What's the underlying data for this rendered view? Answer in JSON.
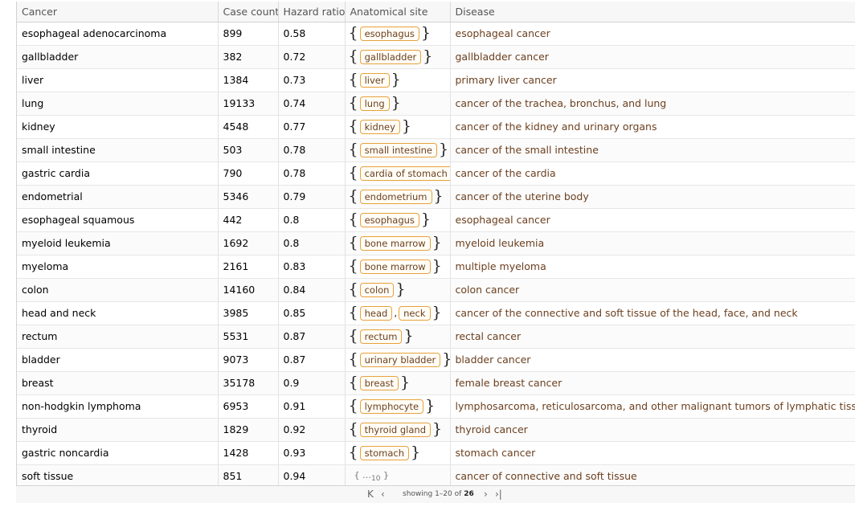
{
  "columns": [
    "Cancer",
    "Case count",
    "Hazard ratio",
    "Anatomical site",
    "Disease"
  ],
  "rows": [
    {
      "cancer": "esophageal adenocarcinoma",
      "count": "899",
      "hazard": "0.58",
      "sites": [
        "esophagus"
      ],
      "disease": "esophageal cancer"
    },
    {
      "cancer": "gallbladder",
      "count": "382",
      "hazard": "0.72",
      "sites": [
        "gallbladder"
      ],
      "disease": "gallbladder cancer"
    },
    {
      "cancer": "liver",
      "count": "1384",
      "hazard": "0.73",
      "sites": [
        "liver"
      ],
      "disease": "primary liver cancer"
    },
    {
      "cancer": "lung",
      "count": "19133",
      "hazard": "0.74",
      "sites": [
        "lung"
      ],
      "disease": "cancer of the trachea, bronchus, and lung"
    },
    {
      "cancer": "kidney",
      "count": "4548",
      "hazard": "0.77",
      "sites": [
        "kidney"
      ],
      "disease": "cancer of the kidney and urinary organs"
    },
    {
      "cancer": "small intestine",
      "count": "503",
      "hazard": "0.78",
      "sites": [
        "small intestine"
      ],
      "disease": "cancer of the small intestine"
    },
    {
      "cancer": "gastric cardia",
      "count": "790",
      "hazard": "0.78",
      "sites": [
        "cardia of stomach"
      ],
      "disease": "cancer of the cardia"
    },
    {
      "cancer": "endometrial",
      "count": "5346",
      "hazard": "0.79",
      "sites": [
        "endometrium"
      ],
      "disease": "cancer of the uterine body"
    },
    {
      "cancer": "esophageal squamous",
      "count": "442",
      "hazard": "0.8",
      "sites": [
        "esophagus"
      ],
      "disease": "esophageal cancer"
    },
    {
      "cancer": "myeloid leukemia",
      "count": "1692",
      "hazard": "0.8",
      "sites": [
        "bone marrow"
      ],
      "disease": "myeloid leukemia"
    },
    {
      "cancer": "myeloma",
      "count": "2161",
      "hazard": "0.83",
      "sites": [
        "bone marrow"
      ],
      "disease": "multiple myeloma"
    },
    {
      "cancer": "colon",
      "count": "14160",
      "hazard": "0.84",
      "sites": [
        "colon"
      ],
      "disease": "colon cancer"
    },
    {
      "cancer": "head and neck",
      "count": "3985",
      "hazard": "0.85",
      "sites": [
        "head",
        "neck"
      ],
      "disease": "cancer of the connective and soft tissue of the head, face, and neck"
    },
    {
      "cancer": "rectum",
      "count": "5531",
      "hazard": "0.87",
      "sites": [
        "rectum"
      ],
      "disease": "rectal cancer"
    },
    {
      "cancer": "bladder",
      "count": "9073",
      "hazard": "0.87",
      "sites": [
        "urinary bladder"
      ],
      "disease": "bladder cancer"
    },
    {
      "cancer": "breast",
      "count": "35178",
      "hazard": "0.9",
      "sites": [
        "breast"
      ],
      "disease": "female breast cancer"
    },
    {
      "cancer": "non-hodgkin lymphoma",
      "count": "6953",
      "hazard": "0.91",
      "sites": [
        "lymphocyte"
      ],
      "disease": "lymphosarcoma, reticulosarcoma, and other malignant tumors of lymphatic tissue"
    },
    {
      "cancer": "thyroid",
      "count": "1829",
      "hazard": "0.92",
      "sites": [
        "thyroid gland"
      ],
      "disease": "thyroid cancer"
    },
    {
      "cancer": "gastric noncardia",
      "count": "1428",
      "hazard": "0.93",
      "sites": [
        "stomach"
      ],
      "disease": "stomach cancer"
    },
    {
      "cancer": "soft tissue",
      "count": "851",
      "hazard": "0.94",
      "sites_more": "10",
      "disease": "cancer of connective and soft tissue"
    }
  ],
  "pager": {
    "first_icon": "first-page-icon",
    "prev_icon": "prev-page-icon",
    "next_icon": "next-page-icon",
    "last_icon": "last-page-icon",
    "showing_label": "showing",
    "range": "1–20",
    "of_label": "of",
    "total": "26"
  },
  "colors": {
    "entity_border": "#e8a13b",
    "entity_text": "#6b3f1e",
    "header_bg": "#f7f7f7"
  }
}
